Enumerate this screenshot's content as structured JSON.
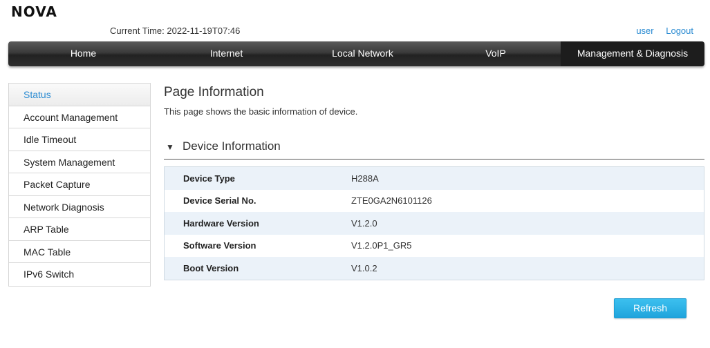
{
  "brand": {
    "logo_text": "NOVA"
  },
  "header": {
    "time_label": "Current Time:",
    "time_value": "2022-11-19T07:46",
    "user_link": "user",
    "logout_link": "Logout"
  },
  "nav": {
    "items": [
      {
        "label": "Home"
      },
      {
        "label": "Internet"
      },
      {
        "label": "Local Network"
      },
      {
        "label": "VoIP"
      },
      {
        "label": "Management & Diagnosis"
      }
    ],
    "active": "Management & Diagnosis"
  },
  "sidebar": {
    "items": [
      {
        "label": "Status"
      },
      {
        "label": "Account Management"
      },
      {
        "label": "Idle Timeout"
      },
      {
        "label": "System Management"
      },
      {
        "label": "Packet Capture"
      },
      {
        "label": "Network Diagnosis"
      },
      {
        "label": "ARP Table"
      },
      {
        "label": "MAC Table"
      },
      {
        "label": "IPv6 Switch"
      }
    ],
    "active": "Status"
  },
  "main": {
    "title": "Page Information",
    "description": "This page shows the basic information of device.",
    "section_title": "Device Information",
    "rows": [
      {
        "key": "Device Type",
        "value": "H288A"
      },
      {
        "key": "Device Serial No.",
        "value": "ZTE0GA2N6101126"
      },
      {
        "key": "Hardware Version",
        "value": "V1.2.0"
      },
      {
        "key": "Software Version",
        "value": "V1.2.0P1_GR5"
      },
      {
        "key": "Boot Version",
        "value": "V1.0.2"
      }
    ],
    "refresh_label": "Refresh"
  },
  "colors": {
    "accent": "#2a8bd2",
    "button": "#22a8df",
    "nav_bg": "#333333",
    "row_alt": "#ebf2f9"
  }
}
